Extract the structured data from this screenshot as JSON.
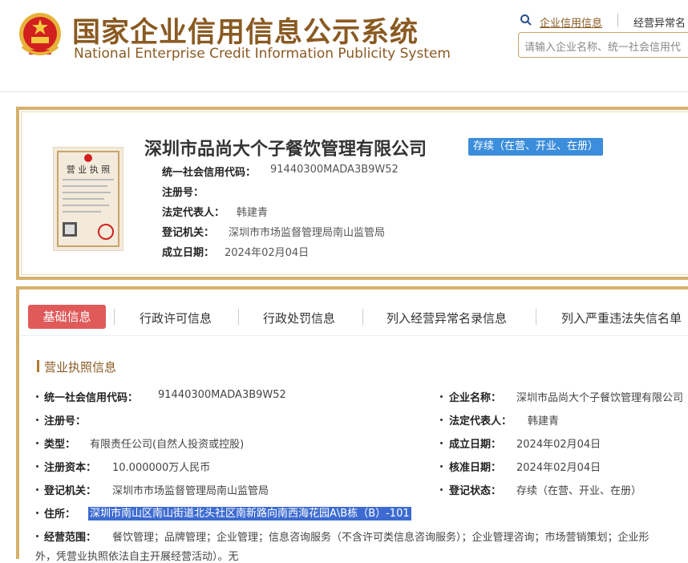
{
  "header": {
    "title_cn": "国家企业信用信息公示系统",
    "title_en": "National Enterprise Credit Information Publicity System",
    "nav_link_1": "企业信用信息",
    "nav_link_2": "经营异常名",
    "search_placeholder": "请输入企业名称、统一社会信用代"
  },
  "company": {
    "name": "深圳市品尚大个子餐饮管理有限公司",
    "status": "存续（在营、开业、在册）",
    "fields": [
      {
        "label": "统一社会信用代码：",
        "value": "91440300MADA3B9W52"
      },
      {
        "label": "注册号：",
        "value": ""
      },
      {
        "label": "法定代表人：",
        "value": "韩建青"
      },
      {
        "label": "登记机关：",
        "value": "深圳市市场监督管理局南山监管局"
      },
      {
        "label": "成立日期：",
        "value": "2024年02月04日"
      }
    ]
  },
  "tabs": [
    "基础信息",
    "行政许可信息",
    "行政处罚信息",
    "列入经营异常名录信息",
    "列入严重违法失信名单"
  ],
  "section": {
    "title": "营业执照信息",
    "left": [
      {
        "label": "统一社会信用代码：",
        "value": "91440300MADA3B9W52"
      },
      {
        "label": "注册号：",
        "value": ""
      },
      {
        "label": "类型：",
        "value": "有限责任公司(自然人投资或控股)"
      },
      {
        "label": "注册资本：",
        "value": "10.000000万人民币"
      },
      {
        "label": "登记机关：",
        "value": "深圳市市场监督管理局南山监管局"
      }
    ],
    "right": [
      {
        "label": "企业名称：",
        "value": "深圳市品尚大个子餐饮管理有限公司"
      },
      {
        "label": "法定代表人：",
        "value": "韩建青"
      },
      {
        "label": "成立日期：",
        "value": "2024年02月04日"
      },
      {
        "label": "核准日期：",
        "value": "2024年02月04日"
      },
      {
        "label": "登记状态：",
        "value": "存续（在营、开业、在册）"
      }
    ],
    "address_label": "住所：",
    "address_value": "深圳市南山区南山街道北头社区南新路向南西海花园A\\B栋（B）-101",
    "scope_label": "经营范围：",
    "scope_value": "餐饮管理；品牌管理；企业管理；信息咨询服务（不含许可类信息咨询服务）；企业管理咨询；市场营销策划；企业形",
    "scope_value_2": "外，凭营业执照依法自主开展经营活动）。无"
  },
  "colors": {
    "brand_gold": "#8a5a22",
    "border_gold": "#d7b16c",
    "badge_blue": "#3c8ddb",
    "tab_red": "#e05a5a",
    "highlight": "#3d6bd1"
  }
}
